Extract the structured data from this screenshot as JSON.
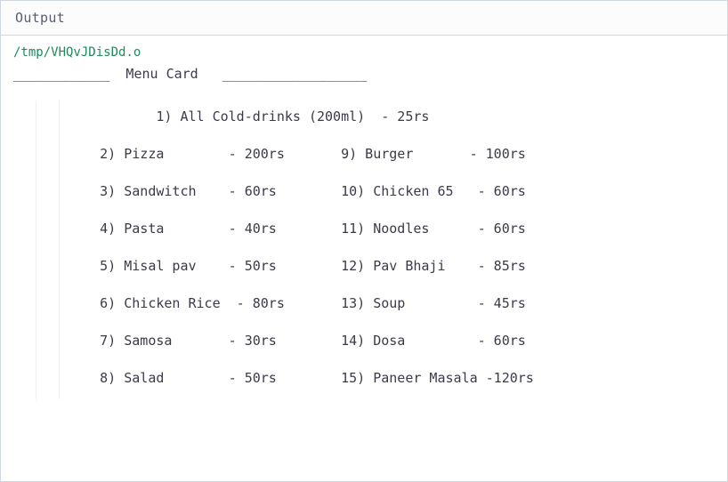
{
  "header": {
    "title": "Output"
  },
  "filepath": "/tmp/VHQvJDisDd.o",
  "menu_title_line": "____________  Menu Card   __________________",
  "first_item": "            1) All Cold-drinks (200ml)  - 25rs",
  "rows": [
    {
      "left": "2) Pizza        - 200rs",
      "right": "9) Burger       - 100rs"
    },
    {
      "left": "3) Sandwitch    - 60rs",
      "right": "10) Chicken 65   - 60rs"
    },
    {
      "left": "4) Pasta        - 40rs",
      "right": "11) Noodles      - 60rs"
    },
    {
      "left": "5) Misal pav    - 50rs",
      "right": "12) Pav Bhaji    - 85rs"
    },
    {
      "left": "6) Chicken Rice  - 80rs",
      "right": "13) Soup         - 45rs"
    },
    {
      "left": "7) Samosa       - 30rs",
      "right": "14) Dosa         - 60rs"
    },
    {
      "left": "8) Salad        - 50rs",
      "right": "15) Paneer Masala -120rs"
    }
  ]
}
